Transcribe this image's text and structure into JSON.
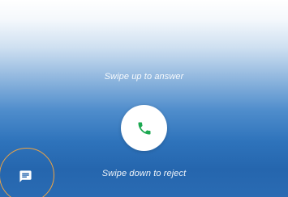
{
  "incoming_call": {
    "answer_hint": "Swipe up to answer",
    "reject_hint": "Swipe down to reject",
    "answer_icon": "phone-icon",
    "message_icon": "message-icon"
  },
  "colors": {
    "answer_icon": "#1da851",
    "highlight_ring": "#f0a442",
    "background_bottom": "#2566ae"
  }
}
